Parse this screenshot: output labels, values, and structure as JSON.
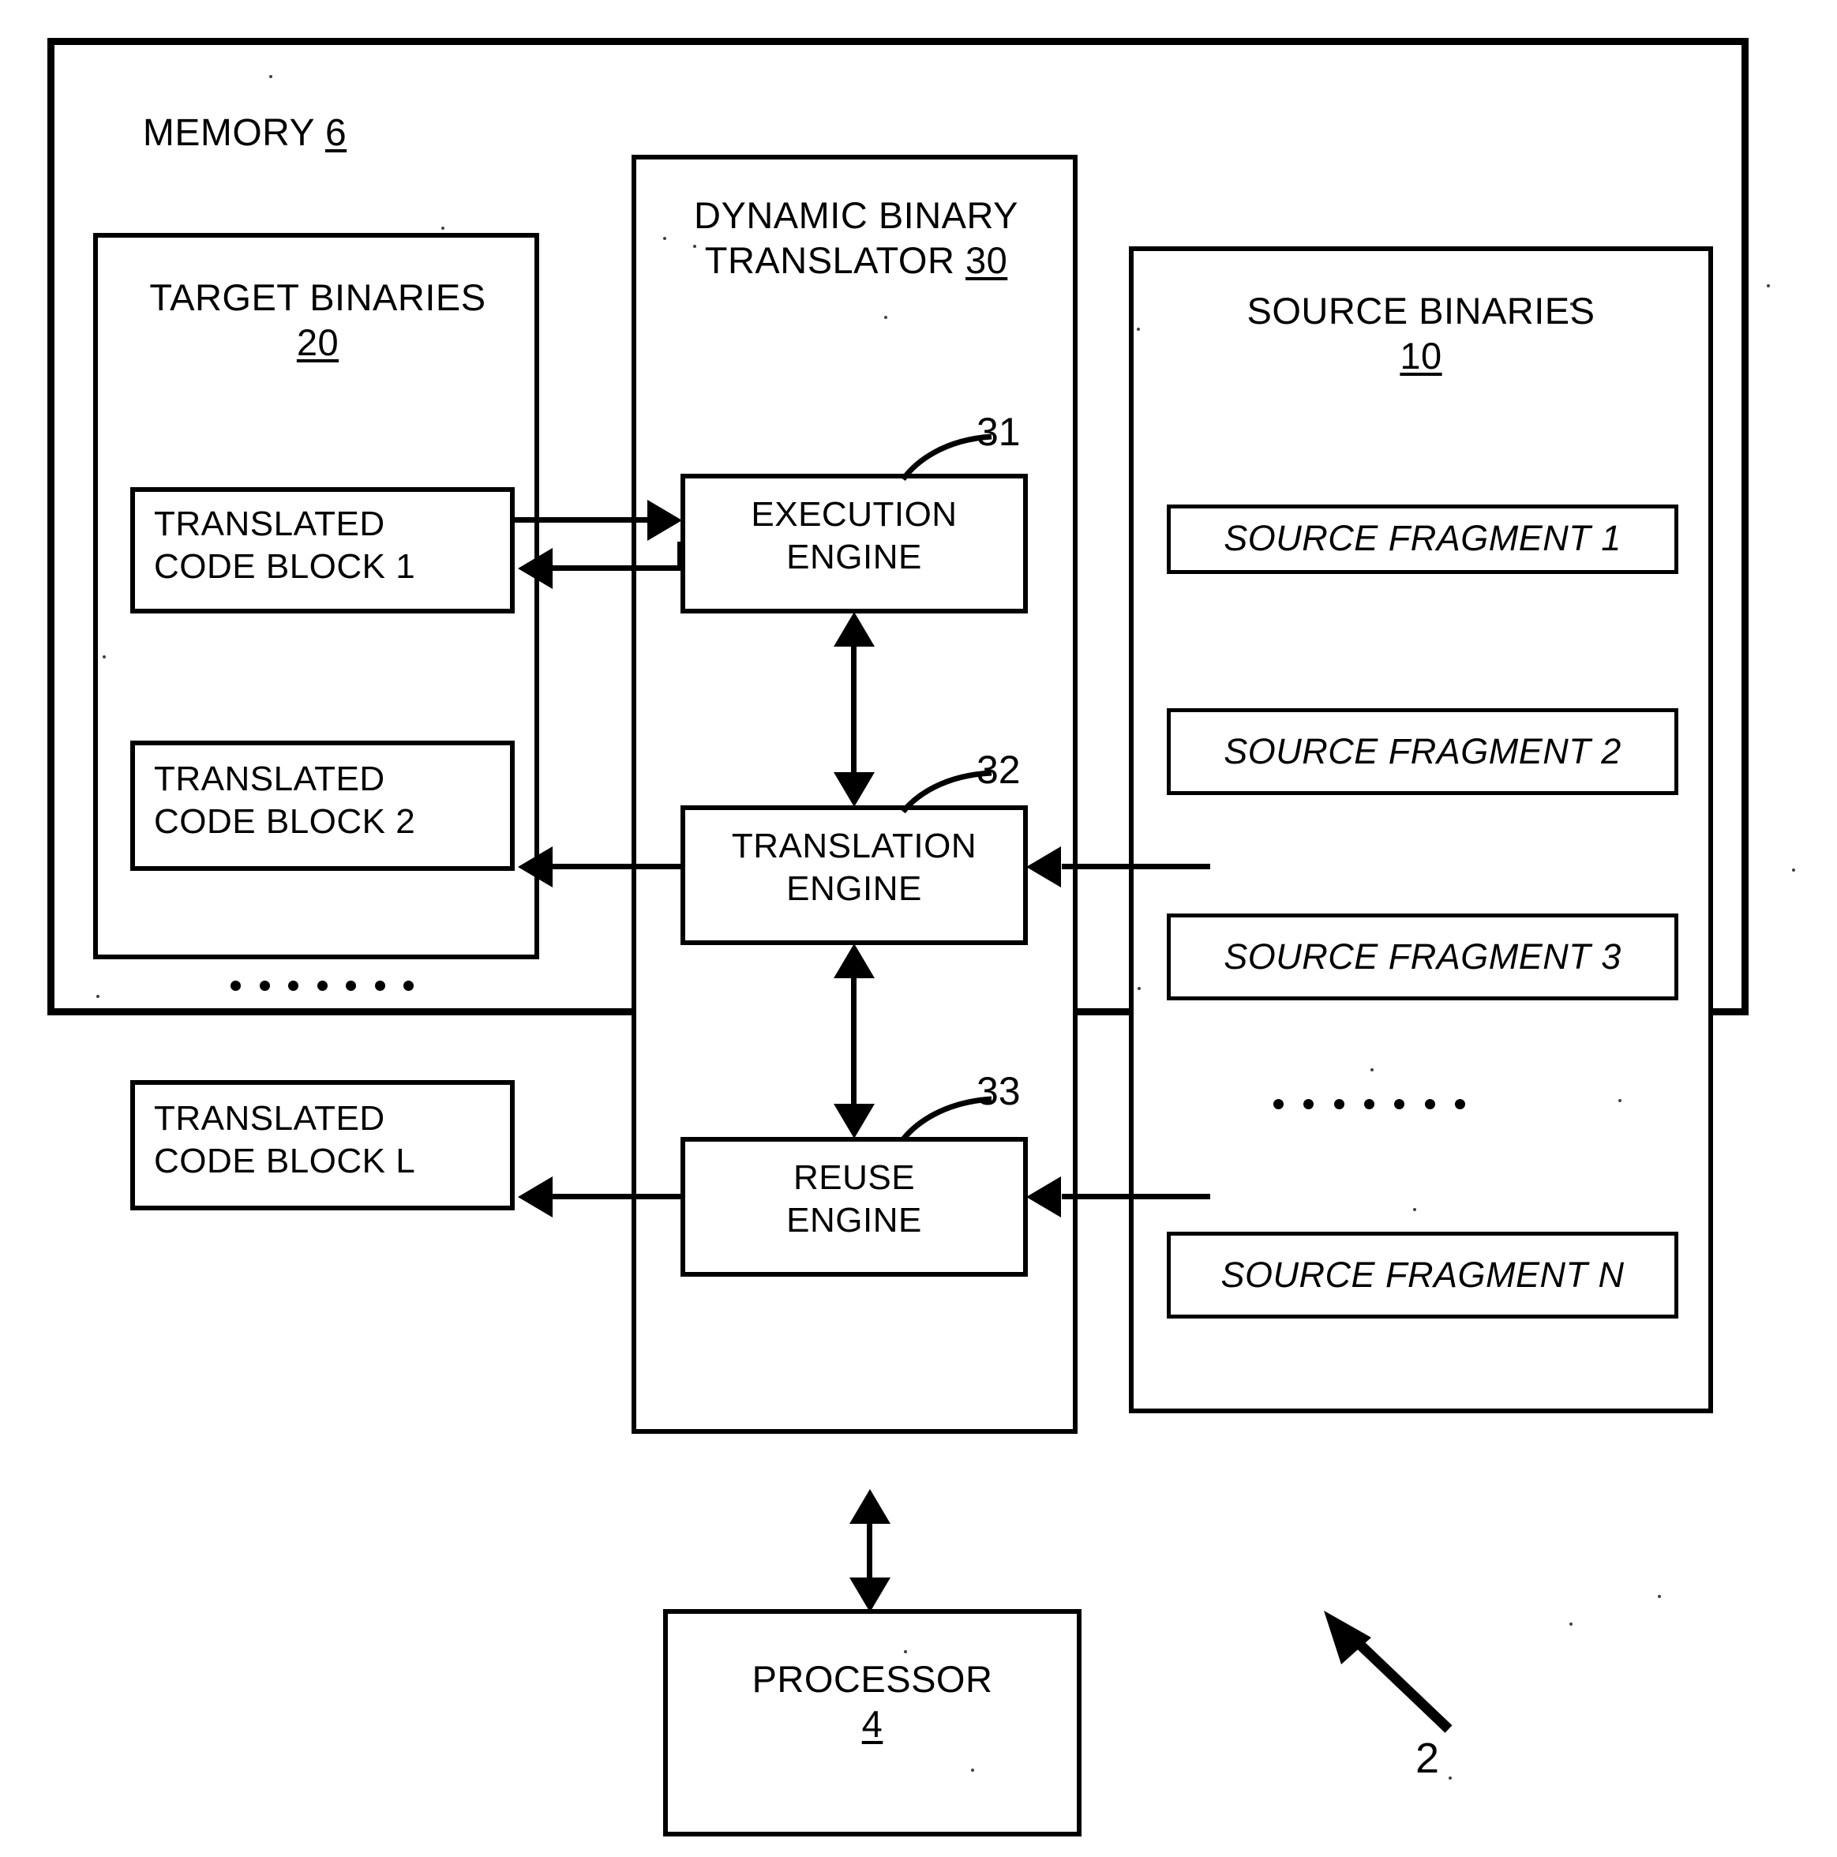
{
  "figure": {
    "system_ref": "2",
    "memory": {
      "title": "MEMORY",
      "ref": "6"
    },
    "target_binaries": {
      "title": "TARGET BINARIES",
      "ref": "20",
      "blocks": [
        "TRANSLATED\nCODE BLOCK 1",
        "TRANSLATED\nCODE BLOCK 2",
        "TRANSLATED\nCODE BLOCK L"
      ],
      "ellipsis_dots": 7
    },
    "translator": {
      "title": "DYNAMIC BINARY\nTRANSLATOR",
      "ref": "30",
      "engines": [
        {
          "label": "EXECUTION\nENGINE",
          "ref": "31"
        },
        {
          "label": "TRANSLATION\nENGINE",
          "ref": "32"
        },
        {
          "label": "REUSE\nENGINE",
          "ref": "33"
        }
      ]
    },
    "source_binaries": {
      "title": "SOURCE BINARIES",
      "ref": "10",
      "fragments": [
        "SOURCE FRAGMENT 1",
        "SOURCE FRAGMENT 2",
        "SOURCE FRAGMENT 3",
        "SOURCE FRAGMENT N"
      ],
      "ellipsis_dots": 7
    },
    "processor": {
      "title": "PROCESSOR",
      "ref": "4"
    }
  },
  "colors": {
    "ink": "#000000",
    "paper": "#ffffff"
  }
}
